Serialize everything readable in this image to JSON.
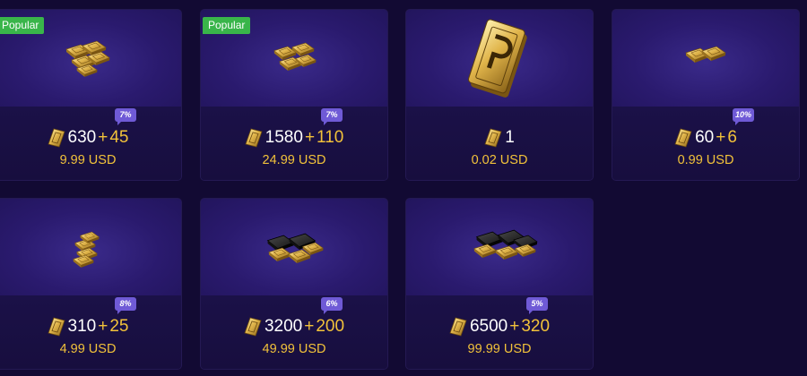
{
  "currency": {
    "icon": "gold-bar-icon",
    "price_color": "#f2c23a",
    "badge_color": "#39b54a",
    "tag_color": "#6f5ad6"
  },
  "cards": [
    {
      "badge": "Popular",
      "bonus_pct": "7%",
      "base": "630",
      "plus": "+",
      "extra": "45",
      "price": "9.99 USD"
    },
    {
      "badge": "Popular",
      "bonus_pct": "7%",
      "base": "1580",
      "plus": "+",
      "extra": "110",
      "price": "24.99 USD"
    },
    {
      "badge": "",
      "bonus_pct": "",
      "base": "1",
      "plus": "",
      "extra": "",
      "price": "0.02 USD"
    },
    {
      "badge": "",
      "bonus_pct": "10%",
      "base": "60",
      "plus": "+",
      "extra": "6",
      "price": "0.99 USD"
    },
    {
      "badge": "",
      "bonus_pct": "8%",
      "base": "310",
      "plus": "+",
      "extra": "25",
      "price": "4.99 USD"
    },
    {
      "badge": "",
      "bonus_pct": "6%",
      "base": "3200",
      "plus": "+",
      "extra": "200",
      "price": "49.99 USD"
    },
    {
      "badge": "",
      "bonus_pct": "5%",
      "base": "6500",
      "plus": "+",
      "extra": "320",
      "price": "99.99 USD"
    }
  ]
}
